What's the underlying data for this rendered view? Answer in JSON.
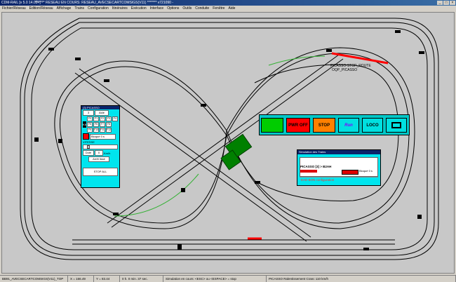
{
  "window": {
    "app_title": "CDM-RAIL [v 5.0 14.09+] -",
    "doc_title": "******* RESEAU EN COURS: RESEAU_AVECSECARTCOMSIGS(V11) ******* v721090 -",
    "controls": [
      "_",
      "□",
      "×"
    ]
  },
  "menu": [
    "Fichier/Réseau",
    "Edition/Réseau",
    "Affichage",
    "Trains",
    "Configuration",
    "Itinéraires",
    "Exécution",
    "Interface",
    "Options",
    "Outils",
    "Conduite",
    "Fenêtre",
    "Aide"
  ],
  "train_labels": {
    "line1": "PICASSO-STOP_ROUTE",
    "line2": "OQP_PICASSO"
  },
  "control_panel": {
    "title": "(3) PICASSO",
    "address_label": "3",
    "aide_label": "Aide",
    "loco_label": "K8",
    "function_rows": [
      [
        "F0",
        "F1",
        "F2",
        "F3",
        "F4"
      ],
      [
        "F5",
        "F6",
        "F7",
        "F8"
      ],
      [
        "F9",
        "F10",
        "F11",
        "F12"
      ]
    ],
    "state_label": "Bloqué  0 s",
    "speed_label": "VITESSE",
    "speed_fraction": 0.1,
    "mode_label": "Dote",
    "value_label": "0",
    "unit_label": "Km/h",
    "stop_delay_label": "Arrêt lissé",
    "stop_all_label": "STOP ALL"
  },
  "command_bar": {
    "buttons": [
      {
        "id": "green",
        "label": "",
        "bg": "#00cc00",
        "color": "#000"
      },
      {
        "id": "pwr",
        "label": "PWR OFF",
        "bg": "#ff0000",
        "color": "#000"
      },
      {
        "id": "stop",
        "label": "STOP",
        "bg": "#ff8000",
        "color": "#000"
      },
      {
        "id": "run",
        "label": "Run",
        "bg": "#00e0e0",
        "color": "#8000ff"
      },
      {
        "id": "loco",
        "label": "LOCO",
        "bg": "#00e0e0",
        "color": "#000"
      },
      {
        "id": "screen",
        "label": "",
        "bg": "#00e0e0",
        "color": "#000"
      }
    ]
  },
  "sim_panel": {
    "title": "Simulation des Trains",
    "train_line": "PICASSO [3] > B2AH",
    "state_label": "Bloqué  0 s",
    "config_line": "EAD BON configuration"
  },
  "status": [
    "BB91_AVECSECARTCOMSIGS(V11)_TOP",
    "X = 166.49",
    "Y = 83.44",
    "0 h. 0 min. 37 sec.",
    "Simulation en cours: <ESC> ou <ESPACE> = stop",
    "PICASSO Ralentissement Cranc 110 km/h"
  ]
}
